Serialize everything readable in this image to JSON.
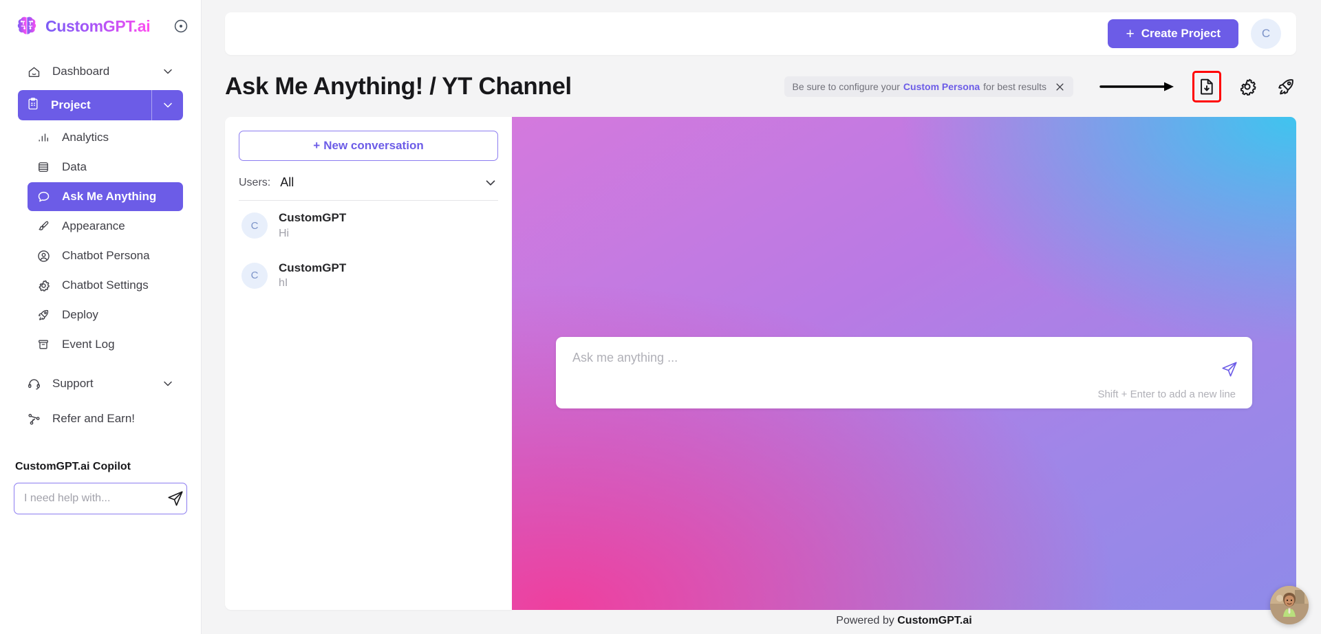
{
  "brand": {
    "name": "CustomGPT.ai",
    "help_icon": "help-circle-icon"
  },
  "sidebar": {
    "dashboard": {
      "label": "Dashboard",
      "icon": "home-icon",
      "caret": "chevron-down-icon"
    },
    "project": {
      "label": "Project",
      "icon": "clipboard-icon",
      "caret": "chevron-down-icon"
    },
    "project_items": [
      {
        "label": "Analytics",
        "icon": "bar-chart-icon",
        "active": false
      },
      {
        "label": "Data",
        "icon": "database-icon",
        "active": false
      },
      {
        "label": "Ask Me Anything",
        "icon": "chat-bubble-icon",
        "active": true
      },
      {
        "label": "Appearance",
        "icon": "paintbrush-icon",
        "active": false
      },
      {
        "label": "Chatbot Persona",
        "icon": "user-circle-icon",
        "active": false
      },
      {
        "label": "Chatbot Settings",
        "icon": "gear-icon",
        "active": false
      },
      {
        "label": "Deploy",
        "icon": "rocket-icon",
        "active": false
      },
      {
        "label": "Event Log",
        "icon": "archive-icon",
        "active": false
      }
    ],
    "support": {
      "label": "Support",
      "icon": "headset-icon",
      "caret": "chevron-down-icon"
    },
    "refer": {
      "label": "Refer and Earn!",
      "icon": "share-nodes-icon"
    },
    "copilot": {
      "title": "CustomGPT.ai Copilot",
      "placeholder": "I need help with...",
      "value": "",
      "send_icon": "send-icon"
    }
  },
  "topbar": {
    "create_project_label": "Create Project",
    "create_project_plus": "+",
    "avatar_initial": "C"
  },
  "header": {
    "title": "Ask Me Anything! / YT Channel",
    "banner": {
      "prefix": "Be sure to configure your",
      "link": "Custom Persona",
      "suffix": "for best results",
      "close_icon": "close-icon"
    },
    "icons": [
      {
        "name": "download-file-icon",
        "highlighted": true
      },
      {
        "name": "gear-icon",
        "highlighted": false
      },
      {
        "name": "rocket-icon",
        "highlighted": false
      }
    ],
    "arrow_hint": "arrow-right-annotation"
  },
  "conversations": {
    "new_conversation_label": "New conversation",
    "new_conversation_plus": "+",
    "users_label": "Users:",
    "users_value": "All",
    "users_caret": "chevron-down-icon",
    "items": [
      {
        "avatar": "C",
        "name": "CustomGPT",
        "message": "Hi"
      },
      {
        "avatar": "C",
        "name": "CustomGPT",
        "message": "hI"
      }
    ]
  },
  "chat": {
    "placeholder": "Ask me anything ...",
    "value": "",
    "hint": "Shift + Enter to add a new line",
    "send_icon": "send-icon"
  },
  "footer": {
    "prefix": "Powered by",
    "brand": "CustomGPT.ai"
  },
  "float_widget": {
    "name": "chat-widget-avatar"
  },
  "colors": {
    "accent": "#6c5ce7",
    "highlight": "#ff0000",
    "gradient_pink": "#ef3f9e",
    "gradient_cyan": "#3fc4ef",
    "gradient_purple": "#9f86e8"
  }
}
